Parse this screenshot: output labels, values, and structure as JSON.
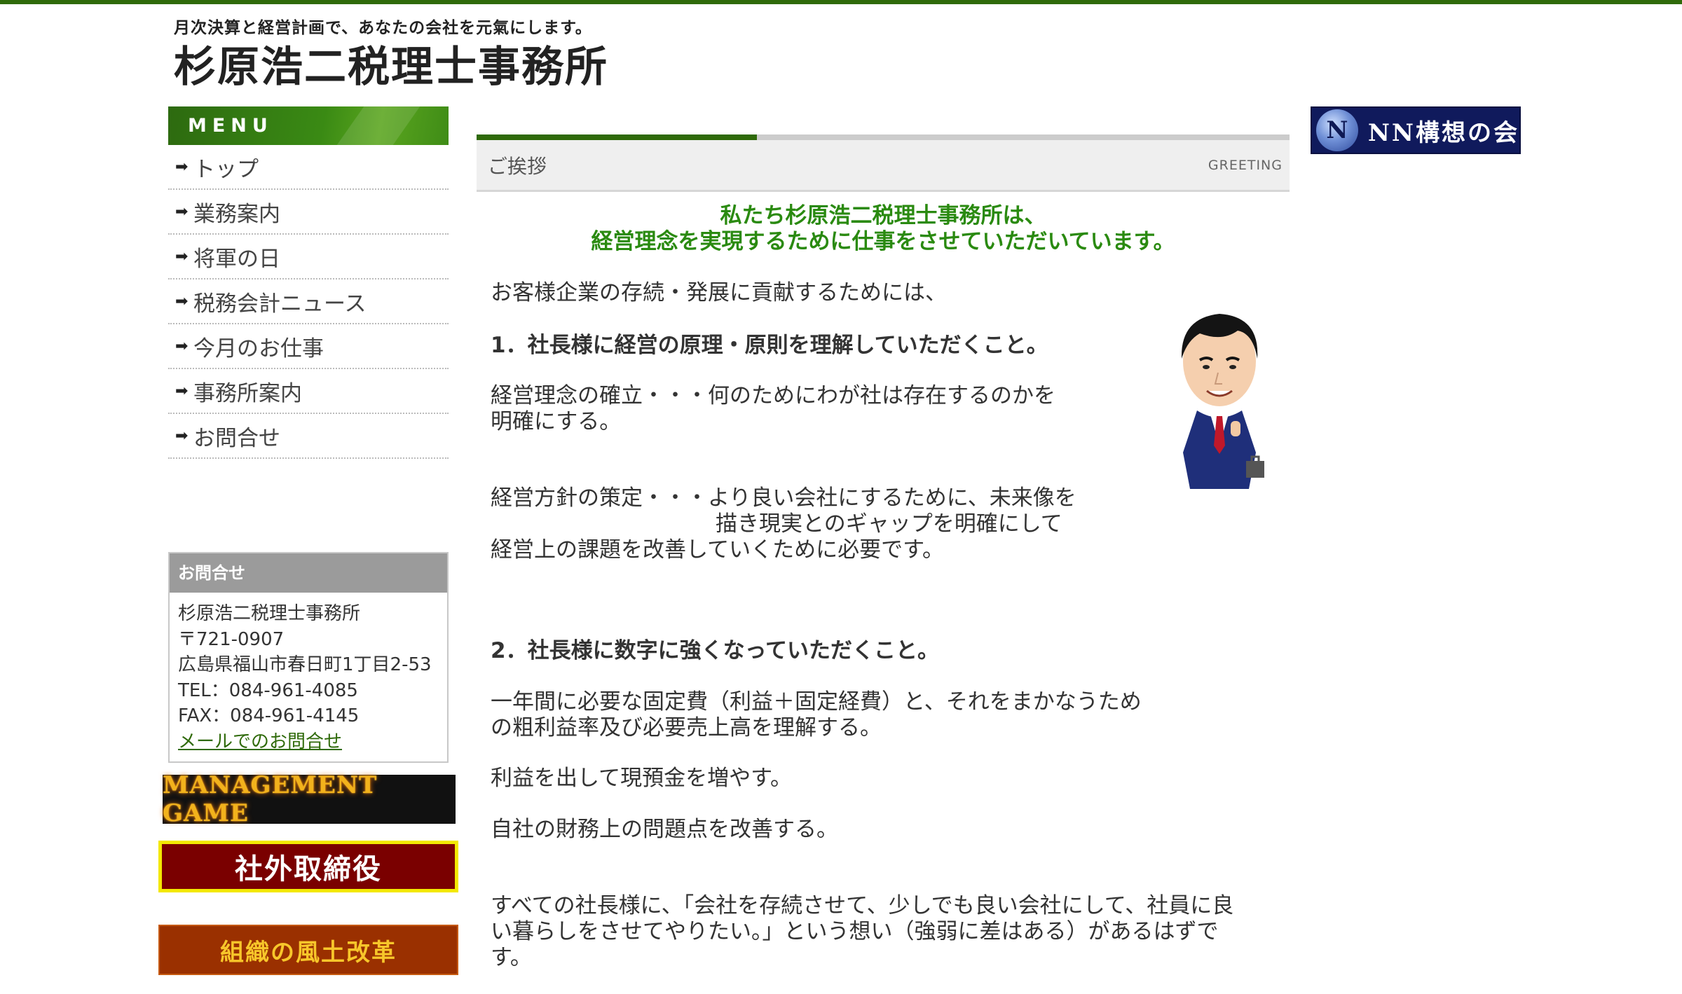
{
  "header": {
    "tagline": "月次決算と経営計画で、あなたの会社を元氣にします。",
    "title": "杉原浩二税理士事務所"
  },
  "menu": {
    "heading": "MENU",
    "items": [
      {
        "label": "トップ"
      },
      {
        "label": "業務案内"
      },
      {
        "label": "将軍の日"
      },
      {
        "label": "税務会計ニュース"
      },
      {
        "label": "今月のお仕事"
      },
      {
        "label": "事務所案内"
      },
      {
        "label": "お問合せ"
      }
    ]
  },
  "contact": {
    "heading": "お問合せ",
    "name": "杉原浩二税理士事務所",
    "postal": "〒721-0907",
    "address": "広島県福山市春日町1丁目2-53",
    "tel": "TEL：084-961-4085",
    "fax": "FAX：084-961-4145",
    "mail_link": "メールでのお問合せ"
  },
  "banners": {
    "management_game": "MANAGEMENT GAME",
    "outside_director": "社外取締役",
    "culture_reform": "組織の風土改革",
    "nn_logo": "N",
    "nn_text": "NN構想の会"
  },
  "section": {
    "title": "ご挨拶",
    "title_en": "GREETING"
  },
  "content": {
    "lead1": "私たち杉原浩二税理士事務所は、",
    "lead2": "経営理念を実現するために仕事をさせていただいています。",
    "intro": "お客様企業の存続・発展に貢献するためには、",
    "point1": "1．社長様に経営の原理・原則を理解していただくこと。",
    "p1a": "経営理念の確立・・・何のためにわが社は存在するのかを",
    "p1b": "明確にする。",
    "p2a": "経営方針の策定・・・より良い会社にするために、未来像を",
    "p2b": "描き現実とのギャップを明確にして",
    "p2c": "経営上の課題を改善していくために必要です。",
    "point2": "2．社長様に数字に強くなっていただくこと。",
    "p3a": "一年間に必要な固定費（利益＋固定経費）と、それをまかなうため",
    "p3b": "の粗利益率及び必要売上高を理解する。",
    "p4": "利益を出して現預金を増やす。",
    "p5": "自社の財務上の問題点を改善する。",
    "p6a": "すべての社長様に、「会社を存続させて、少しでも良い会社にして、社員に良",
    "p6b": "い暮らしをさせてやりたい。」という想い（強弱に差はある）があるはずで",
    "p6c": "す。"
  },
  "colors": {
    "brand_green": "#2f6a0a",
    "lead_green": "#2a8a10",
    "nn_navy": "#101a5c"
  }
}
